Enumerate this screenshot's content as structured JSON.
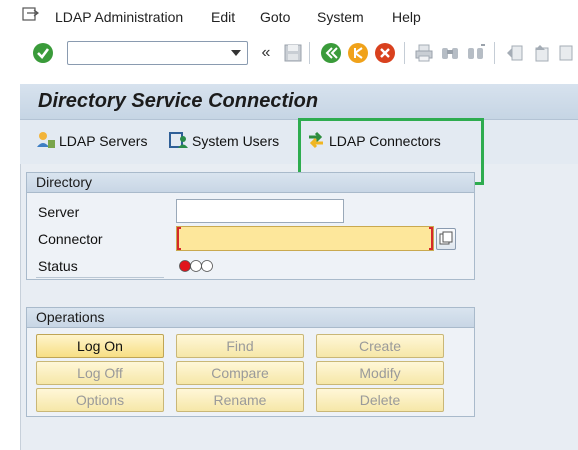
{
  "menubar": {
    "items": [
      "LDAP Administration",
      "Edit",
      "Goto",
      "System",
      "Help"
    ]
  },
  "toolbar": {
    "command_field_value": "",
    "icons": [
      "enter-check-icon",
      "save-icon",
      "back-icon",
      "exit-icon",
      "cancel-icon",
      "print-icon",
      "find-icon",
      "find-next-icon",
      "first-page-icon",
      "previous-page-icon",
      "next-page-icon"
    ]
  },
  "page": {
    "title": "Directory Service Connection"
  },
  "appbar": {
    "ldap_servers": "LDAP Servers",
    "system_users": "System Users",
    "ldap_connectors": "LDAP Connectors"
  },
  "directory": {
    "header": "Directory",
    "server_label": "Server",
    "server_value": "",
    "connector_label": "Connector",
    "connector_value": "",
    "status_label": "Status",
    "status_light": "red"
  },
  "operations": {
    "header": "Operations",
    "buttons": [
      "Log On",
      "Find",
      "Create",
      "Log Off",
      "Compare",
      "Modify",
      "Options",
      "Rename",
      "Delete"
    ]
  },
  "colors": {
    "highlight_box": "#2eac4f",
    "required_field": "#fde79b",
    "status_red": "#e0141c"
  }
}
